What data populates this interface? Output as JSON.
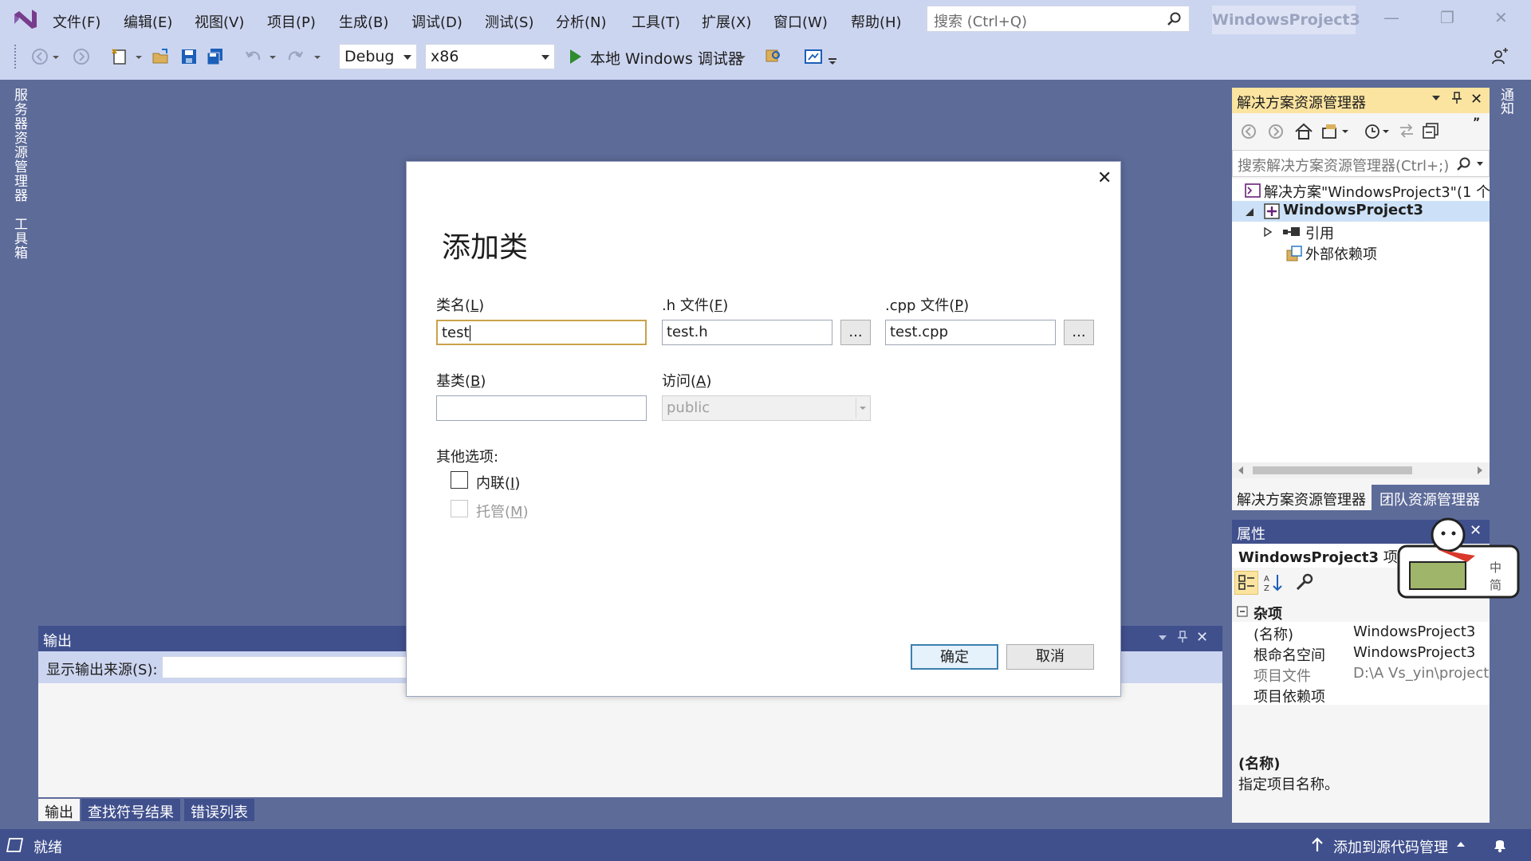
{
  "menubar": {
    "items": [
      "文件(F)",
      "编辑(E)",
      "视图(V)",
      "项目(P)",
      "生成(B)",
      "调试(D)",
      "测试(S)",
      "分析(N)",
      "工具(T)",
      "扩展(X)",
      "窗口(W)",
      "帮助(H)"
    ],
    "search_placeholder": "搜索 (Ctrl+Q)",
    "project_title": "WindowsProject3"
  },
  "toolbar": {
    "config": "Debug",
    "platform": "x86",
    "run_label": "本地 Windows 调试器"
  },
  "left_rail": {
    "server_explorer": "服务器资源管理器",
    "toolbox": "工具箱"
  },
  "right_rail": {
    "notifications": "通知"
  },
  "solution_explorer": {
    "title": "解决方案资源管理器",
    "search_placeholder": "搜索解决方案资源管理器(Ctrl+;)",
    "tree": {
      "solution": "解决方案\"WindowsProject3\"(1 个",
      "project": "WindowsProject3",
      "references": "引用",
      "external_deps": "外部依赖项"
    },
    "tabs": [
      "解决方案资源管理器",
      "团队资源管理器"
    ]
  },
  "properties": {
    "title": "属性",
    "object_name": "WindowsProject3",
    "object_type": "项目",
    "category": "杂项",
    "rows": [
      {
        "name": "(名称)",
        "value": "WindowsProject3"
      },
      {
        "name": "根命名空间",
        "value": "WindowsProject3"
      },
      {
        "name": "项目文件",
        "value": "D:\\A Vs_yin\\project"
      },
      {
        "name": "项目依赖项",
        "value": ""
      }
    ],
    "desc_title": "(名称)",
    "desc_text": "指定项目名称。"
  },
  "output": {
    "title": "输出",
    "source_label": "显示输出来源(S):",
    "tabs": [
      "输出",
      "查找符号结果",
      "错误列表"
    ]
  },
  "statusbar": {
    "ready": "就绪",
    "source_control": "添加到源代码管理"
  },
  "dialog": {
    "title": "添加类",
    "classname_label": "类名(",
    "classname_key": "L",
    "classname_value": "test",
    "hfile_label": ".h 文件(",
    "hfile_key": "F",
    "hfile_value": "test.h",
    "cppfile_label": ".cpp 文件(",
    "cppfile_key": "P",
    "cppfile_value": "test.cpp",
    "browse": "...",
    "baseclass_label": "基类(",
    "baseclass_key": "B",
    "baseclass_value": "",
    "access_label": "访问(",
    "access_key": "A",
    "access_value": "public",
    "other_options": "其他选项:",
    "inline_label": "内联(",
    "inline_key": "I",
    "managed_label": "托管(",
    "managed_key": "M",
    "close_paren": ")",
    "ok": "确定",
    "cancel": "取消"
  },
  "ime_badge": {
    "zh": "中",
    "simp": "简"
  },
  "colors": {
    "accent": "#40508d",
    "background": "#5d6b99",
    "chrome": "#ccd5f0",
    "panel_title_active": "#fbe4a0",
    "focus_border": "#c9a24a"
  }
}
